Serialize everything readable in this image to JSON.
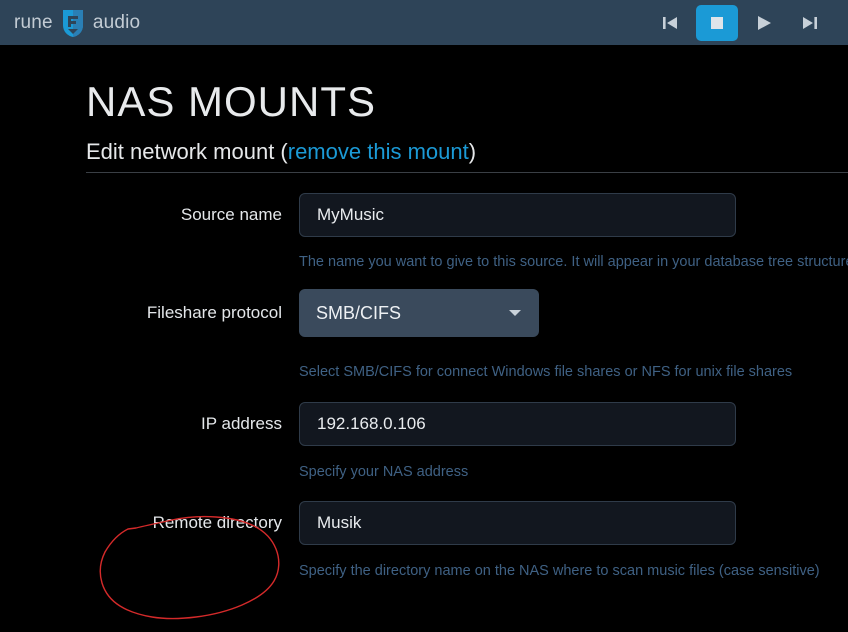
{
  "header": {
    "brand_left": "rune",
    "brand_right": "audio",
    "logo_icon": "runeaudio-shield-logo",
    "transport": [
      {
        "name": "previous-track-button",
        "icon": "skip-previous-icon",
        "active": false
      },
      {
        "name": "stop-button",
        "icon": "stop-icon",
        "active": true
      },
      {
        "name": "play-button",
        "icon": "play-icon",
        "active": false
      },
      {
        "name": "next-track-button",
        "icon": "skip-next-icon",
        "active": false
      }
    ],
    "accent_color": "#1b9ad6",
    "bar_color": "#2e4458"
  },
  "main": {
    "title": "NAS MOUNTS",
    "subtitle_prefix": "Edit network mount (",
    "subtitle_link": "remove this mount",
    "subtitle_suffix": ")"
  },
  "form": {
    "fields": [
      {
        "label": "Source name",
        "value": "MyMusic",
        "help": "The name you want to give to this source. It will appear in your database tree structure",
        "type": "text"
      },
      {
        "label": "Fileshare protocol",
        "value": "SMB/CIFS",
        "help": "Select SMB/CIFS for connect Windows file shares or NFS for unix file shares",
        "type": "select"
      },
      {
        "label": "IP address",
        "value": "192.168.0.106",
        "help": "Specify your NAS address",
        "type": "text"
      },
      {
        "label": "Remote directory",
        "value": "Musik",
        "help": "Specify the directory name on the NAS where to scan music files (case sensitive)",
        "type": "text"
      }
    ]
  },
  "annotation": {
    "name": "red-circle-highlight",
    "target": "Remote directory",
    "color": "#d42a2a"
  }
}
